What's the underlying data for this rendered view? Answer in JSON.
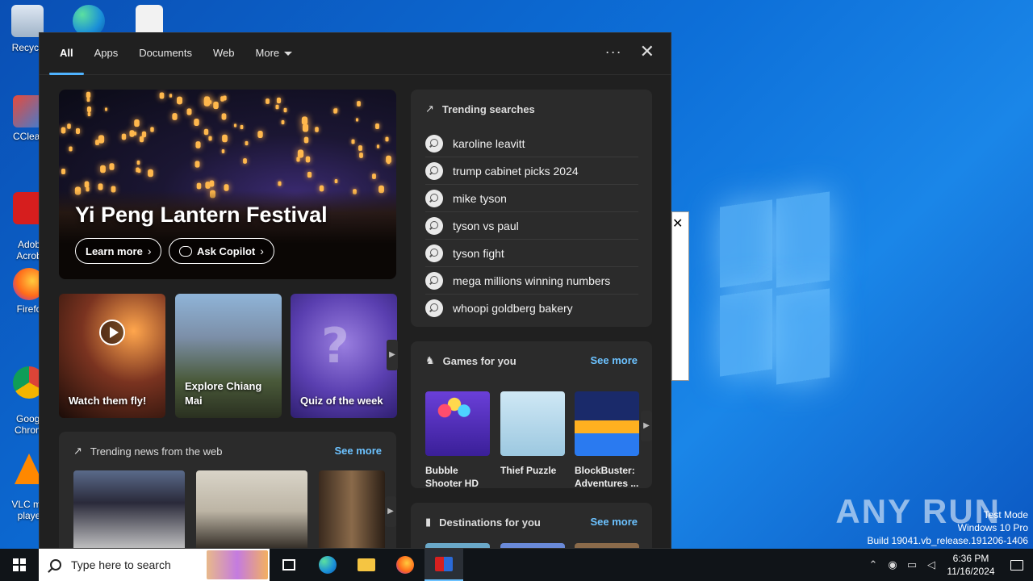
{
  "desktop": {
    "icons": [
      {
        "label": "Recycle"
      },
      {
        "label": "CClean"
      },
      {
        "label": "Adob\nAcrob"
      },
      {
        "label": "Firefo"
      },
      {
        "label": "Googl\nChrom"
      },
      {
        "label": "VLC me\nplaye"
      }
    ],
    "watermark": "ANY RUN",
    "test_mode": [
      "Test Mode",
      "Windows 10 Pro",
      "Build 19041.vb_release.191206-1406"
    ]
  },
  "search_panel": {
    "tabs": [
      {
        "label": "All",
        "active": true
      },
      {
        "label": "Apps"
      },
      {
        "label": "Documents"
      },
      {
        "label": "Web"
      },
      {
        "label": "More"
      }
    ],
    "more_options_label": "···",
    "hero": {
      "title": "Yi Peng Lantern Festival",
      "learn_more": "Learn more",
      "ask_copilot": "Ask Copilot"
    },
    "tiles": [
      {
        "caption": "Watch them fly!"
      },
      {
        "caption": "Explore Chiang Mai"
      },
      {
        "caption": "Quiz of the week"
      }
    ],
    "trending_news": {
      "heading": "Trending news from the web",
      "see_more": "See more"
    },
    "trending_searches": {
      "heading": "Trending searches",
      "items": [
        "karoline leavitt",
        "trump cabinet picks 2024",
        "mike tyson",
        "tyson vs paul",
        "tyson fight",
        "mega millions winning numbers",
        "whoopi goldberg bakery"
      ]
    },
    "games": {
      "heading": "Games for you",
      "see_more": "See more",
      "items": [
        {
          "name": "Bubble Shooter HD"
        },
        {
          "name": "Thief Puzzle"
        },
        {
          "name": "BlockBuster: Adventures ..."
        }
      ]
    },
    "destinations": {
      "heading": "Destinations for you",
      "see_more": "See more"
    }
  },
  "taskbar": {
    "search_placeholder": "Type here to search",
    "time": "6:36 PM",
    "date": "11/16/2024"
  }
}
